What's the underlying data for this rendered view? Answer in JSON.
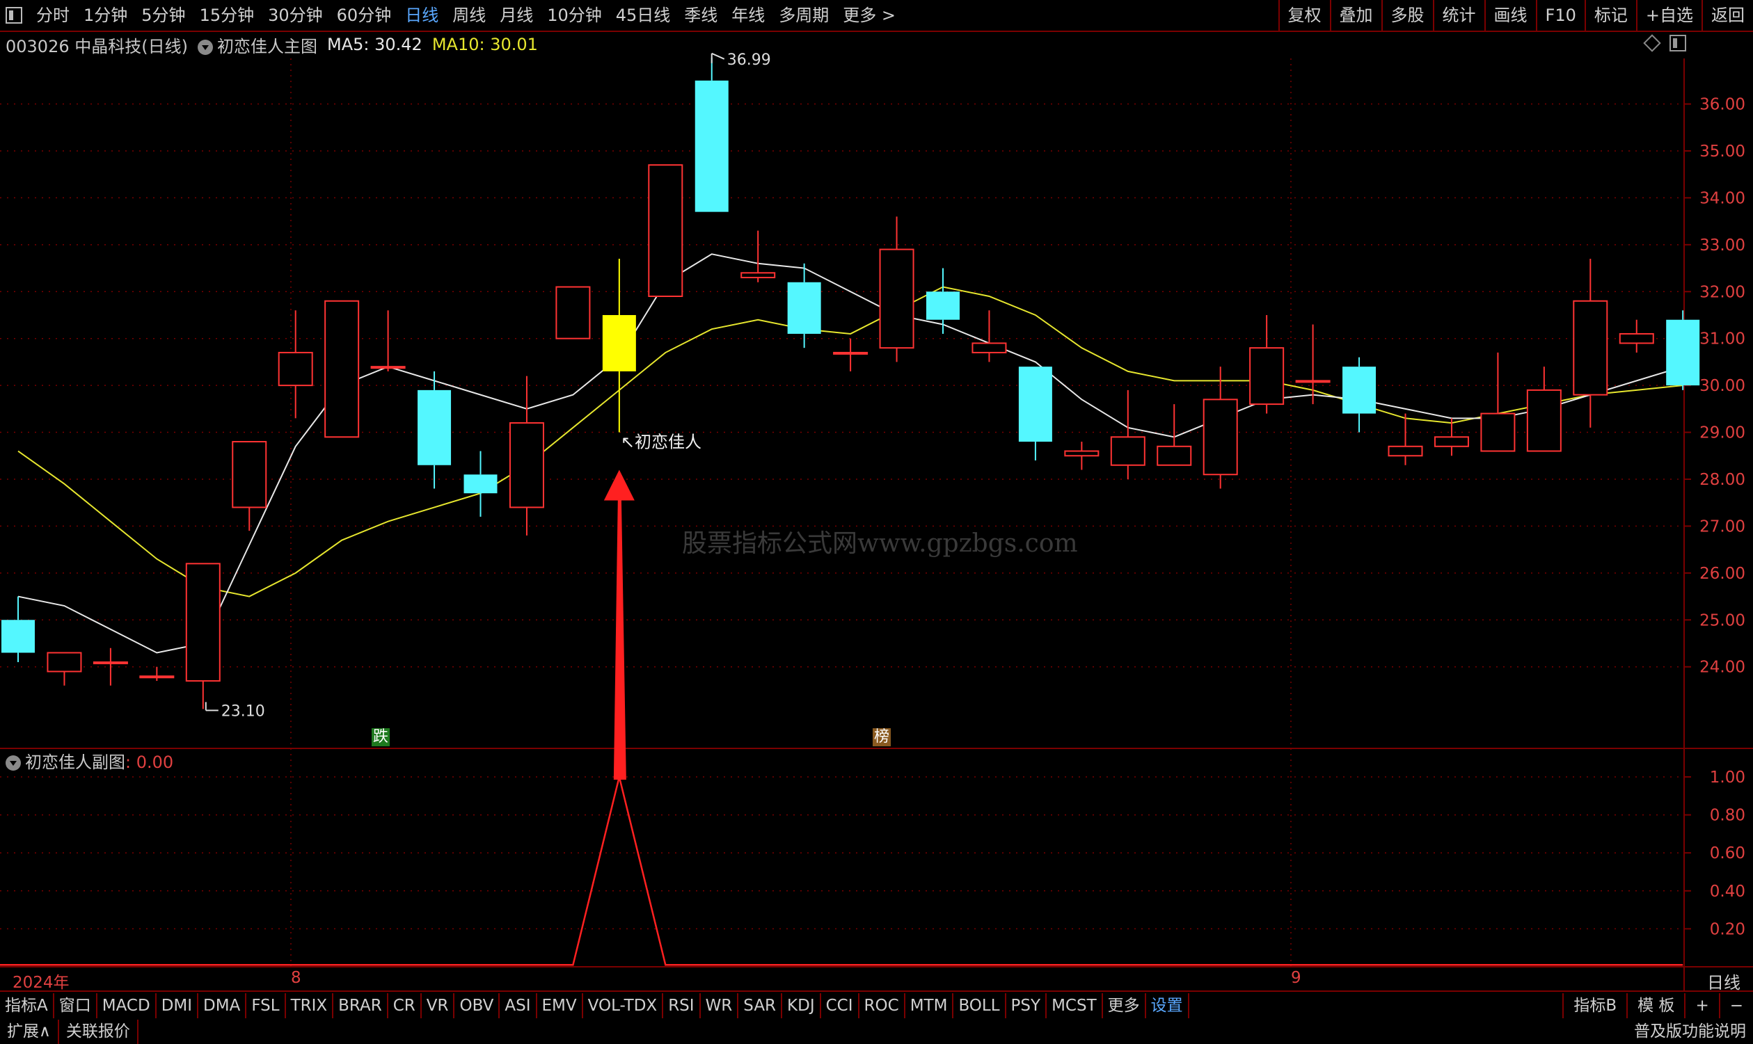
{
  "top_nav": {
    "periods": [
      "分时",
      "1分钟",
      "5分钟",
      "15分钟",
      "30分钟",
      "60分钟",
      "日线",
      "周线",
      "月线",
      "10分钟",
      "45日线",
      "季线",
      "年线",
      "多周期",
      "更多 >"
    ],
    "active": "日线",
    "right_buttons": [
      "复权",
      "叠加",
      "多股",
      "统计",
      "画线",
      "F10",
      "标记",
      "+自选",
      "返回"
    ]
  },
  "info": {
    "stock": "003026 中晶科技(日线)",
    "indicator_name": "初恋佳人主图",
    "ma5_label": "MA5: 30.42",
    "ma10_label": "MA10: 30.01"
  },
  "colors": {
    "up": "#ff3333",
    "down": "#54f7ff",
    "ma5": "#e8e8e8",
    "ma10": "#e6e62e",
    "signal": "#ffff00",
    "grid": "#7a0000",
    "axis_text": "#e04040"
  },
  "chart_data": {
    "type": "candlestick",
    "y_ticks": [
      24.0,
      25.0,
      26.0,
      27.0,
      28.0,
      29.0,
      30.0,
      31.0,
      32.0,
      33.0,
      34.0,
      35.0,
      36.0
    ],
    "candles": [
      {
        "o": 25.0,
        "h": 25.5,
        "l": 24.1,
        "c": 24.3
      },
      {
        "o": 23.9,
        "h": 24.3,
        "l": 23.6,
        "c": 24.3
      },
      {
        "o": 24.1,
        "h": 24.4,
        "l": 23.6,
        "c": 24.1
      },
      {
        "o": 23.8,
        "h": 24.0,
        "l": 23.7,
        "c": 23.8
      },
      {
        "o": 23.7,
        "h": 26.2,
        "l": 23.1,
        "c": 26.2
      },
      {
        "o": 27.4,
        "h": 28.8,
        "l": 26.9,
        "c": 28.8
      },
      {
        "o": 30.0,
        "h": 31.6,
        "l": 29.3,
        "c": 30.7
      },
      {
        "o": 28.9,
        "h": 31.8,
        "l": 28.9,
        "c": 31.8
      },
      {
        "o": 30.4,
        "h": 31.6,
        "l": 30.3,
        "c": 30.4
      },
      {
        "o": 29.9,
        "h": 30.3,
        "l": 27.8,
        "c": 28.3
      },
      {
        "o": 28.1,
        "h": 28.6,
        "l": 27.2,
        "c": 27.7
      },
      {
        "o": 27.4,
        "h": 30.2,
        "l": 26.8,
        "c": 29.2
      },
      {
        "o": 31.0,
        "h": 32.1,
        "l": 31.0,
        "c": 32.1
      },
      {
        "o": 31.5,
        "h": 32.7,
        "l": 29.0,
        "c": 30.3
      },
      {
        "o": 31.9,
        "h": 34.7,
        "l": 31.9,
        "c": 34.7
      },
      {
        "o": 36.5,
        "h": 36.99,
        "l": 33.7,
        "c": 33.7
      },
      {
        "o": 32.3,
        "h": 33.3,
        "l": 32.2,
        "c": 32.4
      },
      {
        "o": 32.2,
        "h": 32.6,
        "l": 30.8,
        "c": 31.1
      },
      {
        "o": 30.7,
        "h": 31.0,
        "l": 30.3,
        "c": 30.7
      },
      {
        "o": 30.8,
        "h": 33.6,
        "l": 30.5,
        "c": 32.9
      },
      {
        "o": 32.0,
        "h": 32.5,
        "l": 31.1,
        "c": 31.4
      },
      {
        "o": 30.7,
        "h": 31.6,
        "l": 30.5,
        "c": 30.9
      },
      {
        "o": 30.4,
        "h": 30.4,
        "l": 28.4,
        "c": 28.8
      },
      {
        "o": 28.5,
        "h": 28.8,
        "l": 28.2,
        "c": 28.6
      },
      {
        "o": 28.3,
        "h": 29.9,
        "l": 28.0,
        "c": 28.9
      },
      {
        "o": 28.3,
        "h": 29.6,
        "l": 28.3,
        "c": 28.7
      },
      {
        "o": 28.1,
        "h": 30.4,
        "l": 27.8,
        "c": 29.7
      },
      {
        "o": 29.6,
        "h": 31.5,
        "l": 29.4,
        "c": 30.8
      },
      {
        "o": 30.1,
        "h": 31.3,
        "l": 29.6,
        "c": 30.1
      },
      {
        "o": 30.4,
        "h": 30.6,
        "l": 29.0,
        "c": 29.4
      },
      {
        "o": 28.5,
        "h": 29.4,
        "l": 28.3,
        "c": 28.7
      },
      {
        "o": 28.7,
        "h": 29.3,
        "l": 28.5,
        "c": 28.9
      },
      {
        "o": 28.6,
        "h": 30.7,
        "l": 28.6,
        "c": 29.4
      },
      {
        "o": 28.6,
        "h": 30.4,
        "l": 28.6,
        "c": 29.9
      },
      {
        "o": 29.8,
        "h": 32.7,
        "l": 29.1,
        "c": 31.8
      },
      {
        "o": 30.9,
        "h": 31.4,
        "l": 30.7,
        "c": 31.1
      },
      {
        "o": 31.4,
        "h": 31.6,
        "l": 29.9,
        "c": 30.0
      }
    ],
    "ma5": [
      25.5,
      25.3,
      24.8,
      24.3,
      24.5,
      26.6,
      28.7,
      30.0,
      30.4,
      30.1,
      29.8,
      29.5,
      29.8,
      30.6,
      32.2,
      32.8,
      32.6,
      32.5,
      32.0,
      31.5,
      31.3,
      30.9,
      30.5,
      29.7,
      29.1,
      28.9,
      29.3,
      29.7,
      29.8,
      29.7,
      29.5,
      29.3,
      29.3,
      29.5,
      29.8,
      30.1,
      30.4
    ],
    "ma10": [
      28.6,
      27.9,
      27.1,
      26.3,
      25.7,
      25.5,
      26.0,
      26.7,
      27.1,
      27.4,
      27.7,
      28.3,
      29.1,
      29.9,
      30.7,
      31.2,
      31.4,
      31.2,
      31.1,
      31.6,
      32.1,
      31.9,
      31.5,
      30.8,
      30.3,
      30.1,
      30.1,
      30.1,
      29.9,
      29.6,
      29.3,
      29.2,
      29.4,
      29.6,
      29.8,
      29.9,
      30.0
    ],
    "signal_index": 13,
    "high_label": "36.99",
    "low_label": "23.10",
    "signal_label": "初恋佳人",
    "sub": {
      "title": "初恋佳人副图",
      "value_text": ": 0.00",
      "y_ticks": [
        0.2,
        0.4,
        0.6,
        0.8,
        1.0
      ],
      "values": [
        0,
        0,
        0,
        0,
        0,
        0,
        0,
        0,
        0,
        0,
        0,
        0,
        0,
        1,
        0,
        0,
        0,
        0,
        0,
        0,
        0,
        0,
        0,
        0,
        0,
        0,
        0,
        0,
        0,
        0,
        0,
        0,
        0,
        0,
        0,
        0,
        0
      ]
    },
    "time_labels": [
      {
        "text": "2024年",
        "x": 18
      },
      {
        "text": "8",
        "x": 418
      },
      {
        "text": "9",
        "x": 1855
      }
    ]
  },
  "tags": [
    {
      "text": "跌",
      "bg": "#1e7a1e",
      "x": 534,
      "y": 1047
    },
    {
      "text": "榜",
      "bg": "#8a5a20",
      "x": 1254,
      "y": 1047
    }
  ],
  "watermark": "股票指标公式网www.gpzbgs.com",
  "period_label": "日线",
  "indicators": [
    "指标A",
    "窗口",
    "MACD",
    "DMI",
    "DMA",
    "FSL",
    "TRIX",
    "BRAR",
    "CR",
    "VR",
    "OBV",
    "ASI",
    "EMV",
    "VOL-TDX",
    "RSI",
    "WR",
    "SAR",
    "KDJ",
    "CCI",
    "ROC",
    "MTM",
    "BOLL",
    "PSY",
    "MCST",
    "更多",
    "设置"
  ],
  "indicators_right": [
    "指标B",
    "模 板",
    "+",
    "−"
  ],
  "ext_left": [
    "扩展∧",
    "关联报价"
  ],
  "ext_right": "普及版功能说明"
}
